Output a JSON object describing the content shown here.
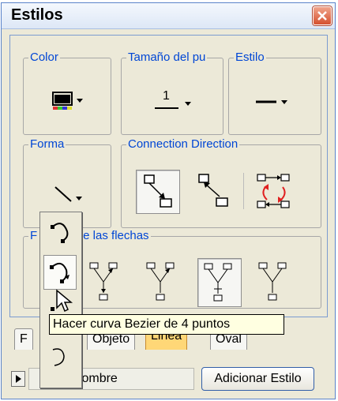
{
  "window": {
    "title": "Estilos"
  },
  "groups": {
    "color": {
      "label": "Color"
    },
    "size": {
      "label": "Tamaño del pu",
      "value": "1"
    },
    "style": {
      "label": "Estilo"
    },
    "shape": {
      "label": "Forma"
    },
    "direction": {
      "label": "Connection Direction"
    },
    "arrows": {
      "label_left": "F",
      "label_right": "e las flechas"
    }
  },
  "tabs": [
    "F",
    "Objeto",
    "Linea",
    "Oval"
  ],
  "active_tab": "Linea",
  "footer": {
    "name_value": "Sin nombre",
    "add_button": "Adicionar Estilo"
  },
  "tooltip": "Hacer curva Bezier de 4 puntos",
  "icons": [
    "close-icon",
    "color-swatch-icon",
    "line-width-icon",
    "line-style-icon",
    "line-shape-icon",
    "connection-down-icon",
    "connection-up-icon",
    "connection-bidirectional-icon",
    "arrow-bundle-icon",
    "bezier-curve-icon",
    "mouse-cursor-icon",
    "dropdown-arrow-icon",
    "play-arrow-icon"
  ],
  "colors": {
    "legend_text": "#0046d5",
    "active_tab": "#ffd777",
    "tooltip_bg": "#ffffe1",
    "accent_red": "#e02020"
  }
}
